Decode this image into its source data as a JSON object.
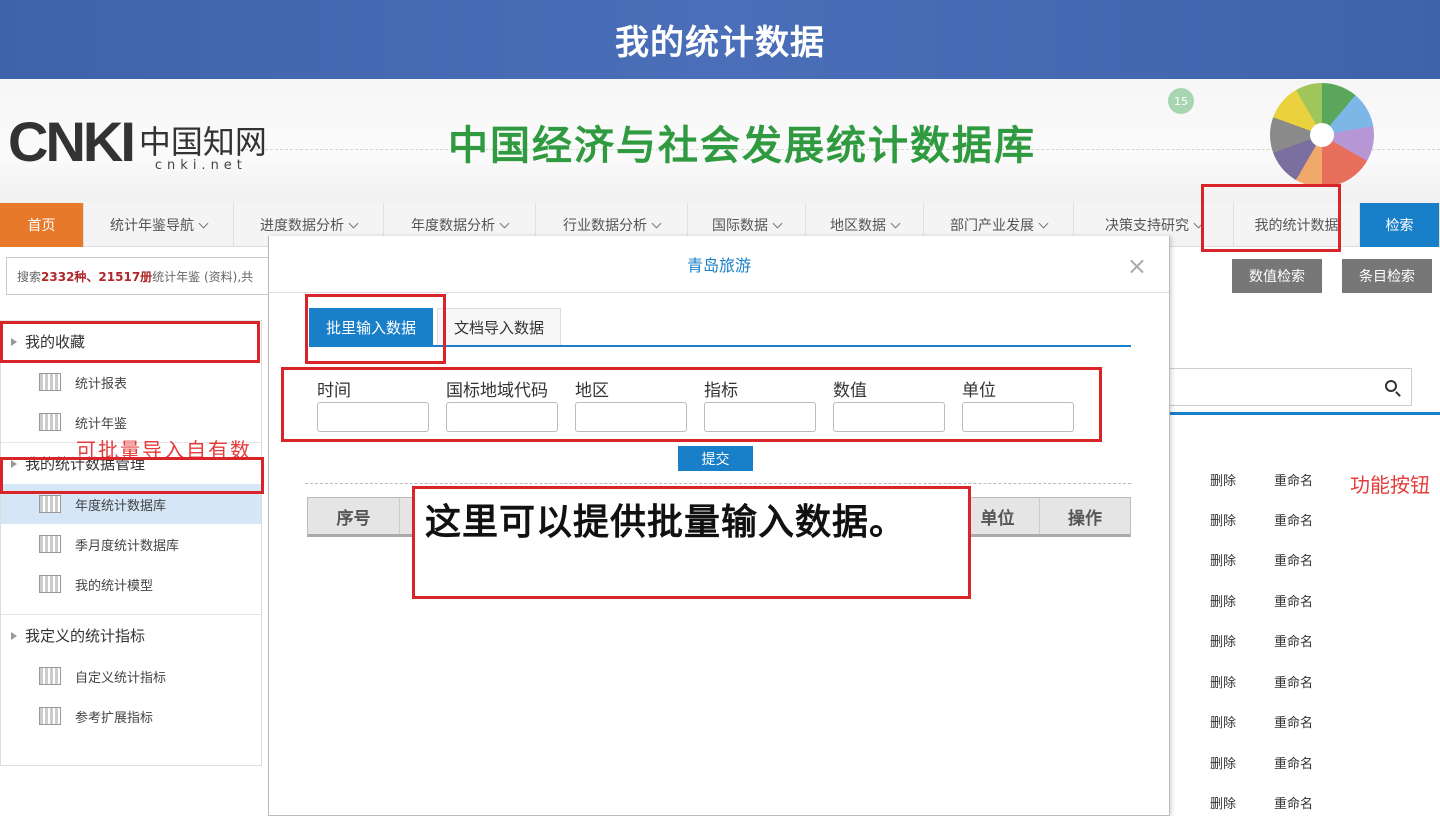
{
  "slide": {
    "title": "我的统计数据"
  },
  "banner": {
    "logo_text": "CNKI",
    "logo_chinese": "中国知网",
    "logo_url_text": "cnki.net",
    "site_title": "中国经济与社会发展统计数据库",
    "deco_badge": "15"
  },
  "nav": {
    "items": [
      "首页",
      "统计年鉴导航",
      "进度数据分析",
      "年度数据分析",
      "行业数据分析",
      "国际数据",
      "地区数据",
      "部门产业发展",
      "决策支持研究",
      "我的统计数据",
      "检索"
    ]
  },
  "search": {
    "prefix": "搜索",
    "count_kinds": "2332种、21517册",
    "suffix": "统计年鉴 (资料),共",
    "value_search_label": "数值检索",
    "entry_search_label": "条目检索"
  },
  "sidebar": {
    "group1": "我的收藏",
    "group1_items": [
      "统计报表",
      "统计年鉴"
    ],
    "group2": "我的统计数据管理",
    "group2_items": [
      "年度统计数据库",
      "季月度统计数据库",
      "我的统计模型"
    ],
    "group3": "我定义的统计指标",
    "group3_items": [
      "自定义统计指标",
      "参考扩展指标"
    ],
    "annotation": "可批量导入自有数"
  },
  "right_panel": {
    "delete_label": "删除",
    "rename_label": "重命名",
    "function_label": "功能按钮"
  },
  "modal": {
    "title": "青岛旅游",
    "close_glyph": "×",
    "tabs": [
      "批里输入数据",
      "文档导入数据"
    ],
    "fields": [
      "时间",
      "国标地域代码",
      "地区",
      "指标",
      "数值",
      "单位"
    ],
    "submit_label": "提交",
    "table_headers": [
      "序号",
      "",
      "",
      "",
      "",
      "单位",
      "操作"
    ]
  },
  "callout": {
    "text": "这里可以提供批量输入数据。"
  },
  "colors": {
    "accent": "#1a7fc9",
    "annotation_red": "#d9252a",
    "home_orange": "#e8792b",
    "title_green": "#2f9a3f"
  }
}
